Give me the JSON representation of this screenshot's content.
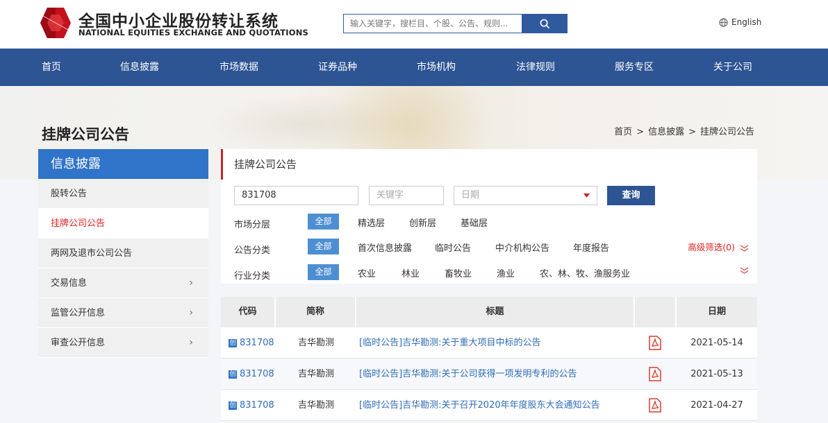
{
  "header": {
    "logo_cn": "全国中小企业股份转让系统",
    "logo_en": "NATIONAL EQUITIES EXCHANGE AND QUOTATIONS",
    "search_placeholder": "输入关键字，搜栏目、个股、公告、规则...",
    "language": "English"
  },
  "nav": [
    "首页",
    "信息披露",
    "市场数据",
    "证券品种",
    "市场机构",
    "法律规则",
    "服务专区",
    "关于公司"
  ],
  "page": {
    "title": "挂牌公司公告",
    "breadcrumb": [
      "首页",
      "信息披露",
      "挂牌公司公告"
    ]
  },
  "sidebar": {
    "heading": "信息披露",
    "items": [
      {
        "label": "股转公告",
        "active": false,
        "expandable": false
      },
      {
        "label": "挂牌公司公告",
        "active": true,
        "expandable": false
      },
      {
        "label": "两网及退市公司公告",
        "active": false,
        "expandable": false
      },
      {
        "label": "交易信息",
        "active": false,
        "expandable": true
      },
      {
        "label": "监管公开信息",
        "active": false,
        "expandable": true
      },
      {
        "label": "审查公开信息",
        "active": false,
        "expandable": true
      }
    ]
  },
  "filter": {
    "title": "挂牌公司公告",
    "code_value": "831708",
    "keyword_placeholder": "关键字",
    "date_placeholder": "日期",
    "query_label": "查询",
    "rows": [
      {
        "label": "市场分层",
        "all": "全部",
        "options": [
          "精选层",
          "创新层",
          "基础层"
        ]
      },
      {
        "label": "公告分类",
        "all": "全部",
        "options": [
          "首次信息披露",
          "临时公告",
          "中介机构公告",
          "年度报告"
        ]
      },
      {
        "label": "行业分类",
        "all": "全部",
        "options": [
          "农业",
          "林业",
          "畜牧业",
          "渔业",
          "农、林、牧、渔服务业"
        ]
      }
    ],
    "advanced_label": "高级筛选(0)"
  },
  "table": {
    "headers": [
      "代码",
      "简称",
      "标题",
      "",
      "日期"
    ],
    "rows": [
      {
        "code": "831708",
        "name": "吉华勘测",
        "title": "[临时公告]吉华勘测:关于重大项目中标的公告",
        "date": "2021-05-14"
      },
      {
        "code": "831708",
        "name": "吉华勘测",
        "title": "[临时公告]吉华勘测:关于公司获得一项发明专利的公告",
        "date": "2021-05-13"
      },
      {
        "code": "831708",
        "name": "吉华勘测",
        "title": "[临时公告]吉华勘测:关于召开2020年年度股东大会通知公告",
        "date": "2021-04-27"
      }
    ]
  },
  "colors": {
    "nav_bg": "#2d5493",
    "sidebar_active": "#e02020",
    "link": "#2f6cb7",
    "accent_red": "#c7252b"
  }
}
